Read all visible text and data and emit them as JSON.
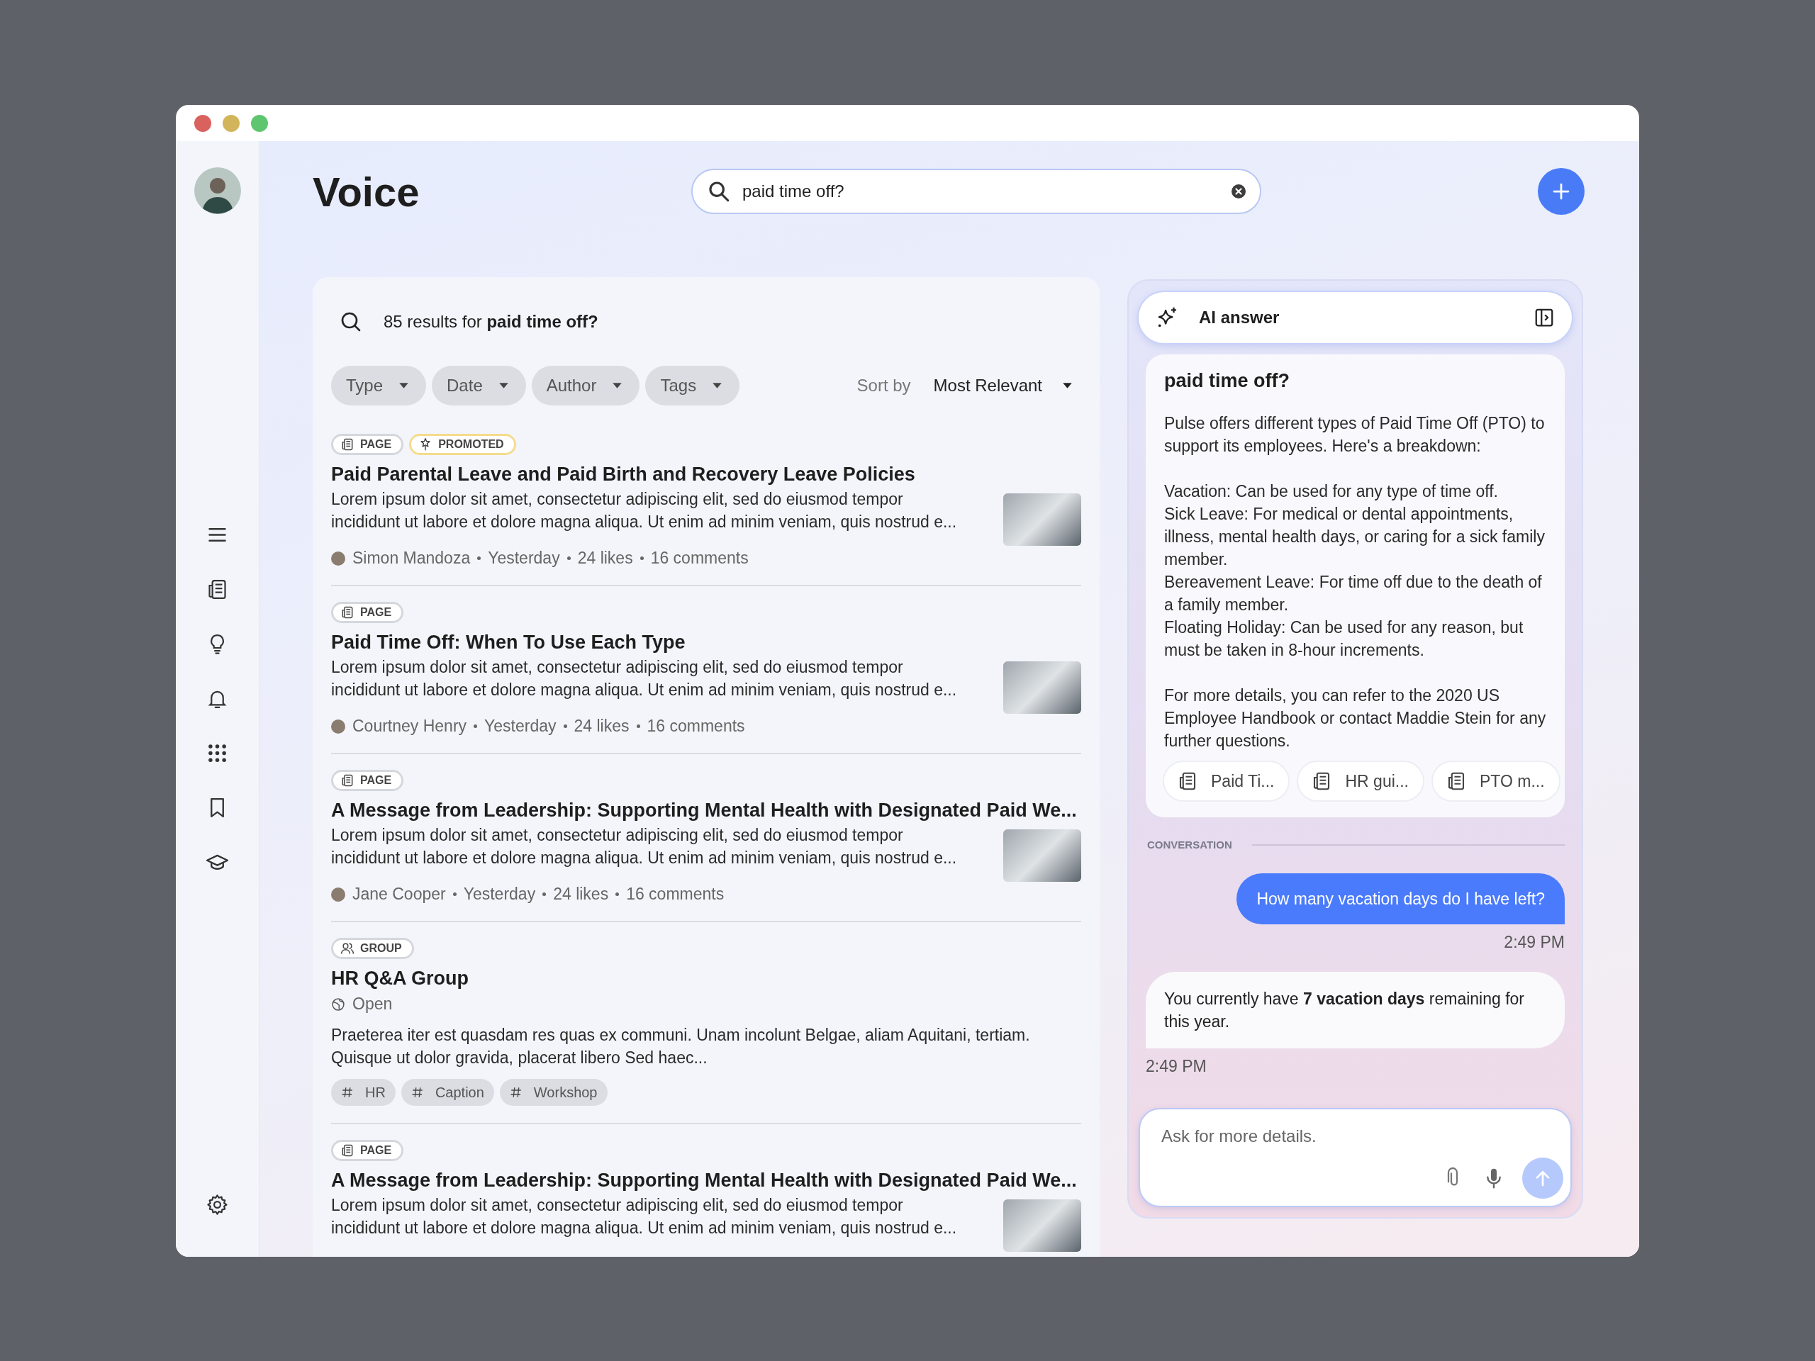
{
  "app": {
    "title": "Voice"
  },
  "search": {
    "value": "paid time off?"
  },
  "results": {
    "summary": "85 results for **paid time off?**",
    "filters": [
      "Type",
      "Date",
      "Author",
      "Tags"
    ],
    "sort": {
      "label": "Sort by",
      "value": "Most Relevant"
    },
    "items": [
      {
        "kind": "page",
        "badges": [
          {
            "kind": "page",
            "label": "PAGE"
          },
          {
            "kind": "promoted",
            "label": "PROMOTED"
          }
        ],
        "title": "Paid Parental Leave and Paid Birth and Recovery Leave Policies",
        "excerpt": "Lorem ipsum dolor sit amet, consectetur adipiscing elit, sed do eiusmod tempor incididunt ut labore et dolore magna aliqua. Ut enim ad minim veniam, quis nostrud e...",
        "author": "Simon Mandoza",
        "date": "Yesterday",
        "likes": "24 likes",
        "comments": "16 comments"
      },
      {
        "kind": "page",
        "badges": [
          {
            "kind": "page",
            "label": "PAGE"
          }
        ],
        "title": "Paid Time Off: When To Use Each Type",
        "excerpt": "Lorem ipsum dolor sit amet, consectetur adipiscing elit, sed do eiusmod tempor incididunt ut labore et dolore magna aliqua. Ut enim ad minim veniam, quis nostrud e...",
        "author": "Courtney Henry",
        "date": "Yesterday",
        "likes": "24 likes",
        "comments": "16 comments"
      },
      {
        "kind": "page",
        "badges": [
          {
            "kind": "page",
            "label": "PAGE"
          }
        ],
        "title": "A Message from Leadership: Supporting Mental Health with Designated Paid We...",
        "excerpt": "Lorem ipsum dolor sit amet, consectetur adipiscing elit, sed do eiusmod tempor incididunt ut labore et dolore magna aliqua. Ut enim ad minim veniam, quis nostrud e...",
        "author": "Jane Cooper",
        "date": "Yesterday",
        "likes": "24 likes",
        "comments": "16 comments"
      },
      {
        "kind": "group",
        "badges": [
          {
            "kind": "group",
            "label": "GROUP"
          }
        ],
        "title": "HR Q&A Group",
        "status": "Open",
        "excerpt": "Praeterea iter est quasdam res quas ex communi. Unam incolunt Belgae, aliam Aquitani, tertiam. Quisque ut dolor gravida, placerat libero Sed haec...",
        "tags": [
          "HR",
          "Caption",
          "Workshop"
        ]
      },
      {
        "kind": "page",
        "badges": [
          {
            "kind": "page",
            "label": "PAGE"
          }
        ],
        "title": "A Message from Leadership: Supporting Mental Health with Designated Paid We...",
        "excerpt": "Lorem ipsum dolor sit amet, consectetur adipiscing elit, sed do eiusmod tempor incididunt ut labore et dolore magna aliqua. Ut enim ad minim veniam, quis nostrud e..."
      }
    ]
  },
  "ai": {
    "title": "AI answer",
    "question": "paid time off?",
    "answer": "Pulse offers different types of Paid Time Off (PTO) to support its employees. Here's a breakdown:\n\nVacation: Can be used for any type of time off.\nSick Leave: For medical or dental appointments, illness, mental health days, or caring for a sick family member.\nBereavement Leave: For time off due to the death of a family member.\nFloating Holiday: Can be used for any reason, but must be taken in 8-hour increments.\n\nFor more details, you can refer to the 2020 US Employee Handbook or contact Maddie Stein for any further questions.",
    "sources": [
      "Paid Ti...",
      "HR gui...",
      "PTO m..."
    ],
    "conversation_label": "CONVERSATION",
    "messages": [
      {
        "kind": "user",
        "text": "How many vacation days do I have left?",
        "time": "2:49 PM"
      },
      {
        "kind": "assistant",
        "text": "You currently have **7 vacation days** remaining for this year.",
        "time": "2:49 PM"
      }
    ],
    "input": {
      "placeholder": "Ask for more details."
    }
  }
}
